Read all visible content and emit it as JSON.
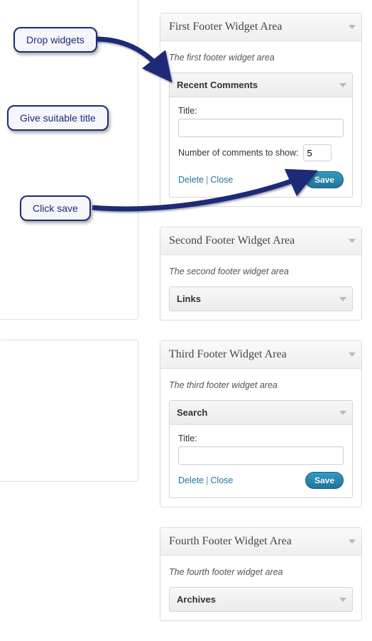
{
  "callouts": {
    "drop": "Drop widgets",
    "title": "Give suitable title",
    "save": "Click save"
  },
  "areas": [
    {
      "title": "First Footer Widget Area",
      "desc": "The first footer widget area",
      "widgets": [
        {
          "name": "Recent Comments",
          "expanded": true,
          "fields": {
            "title_label": "Title:",
            "title_value": "",
            "count_label": "Number of comments to show:",
            "count_value": "5"
          },
          "actions": {
            "delete": "Delete",
            "close": "Close",
            "save": "Save"
          }
        }
      ]
    },
    {
      "title": "Second Footer Widget Area",
      "desc": "The second footer widget area",
      "widgets": [
        {
          "name": "Links",
          "expanded": false
        }
      ]
    },
    {
      "title": "Third Footer Widget Area",
      "desc": "The third footer widget area",
      "widgets": [
        {
          "name": "Search",
          "expanded": true,
          "fields": {
            "title_label": "Title:",
            "title_value": ""
          },
          "actions": {
            "delete": "Delete",
            "close": "Close",
            "save": "Save"
          }
        }
      ]
    },
    {
      "title": "Fourth Footer Widget Area",
      "desc": "The fourth footer widget area",
      "widgets": [
        {
          "name": "Archives",
          "expanded": false
        }
      ]
    }
  ]
}
